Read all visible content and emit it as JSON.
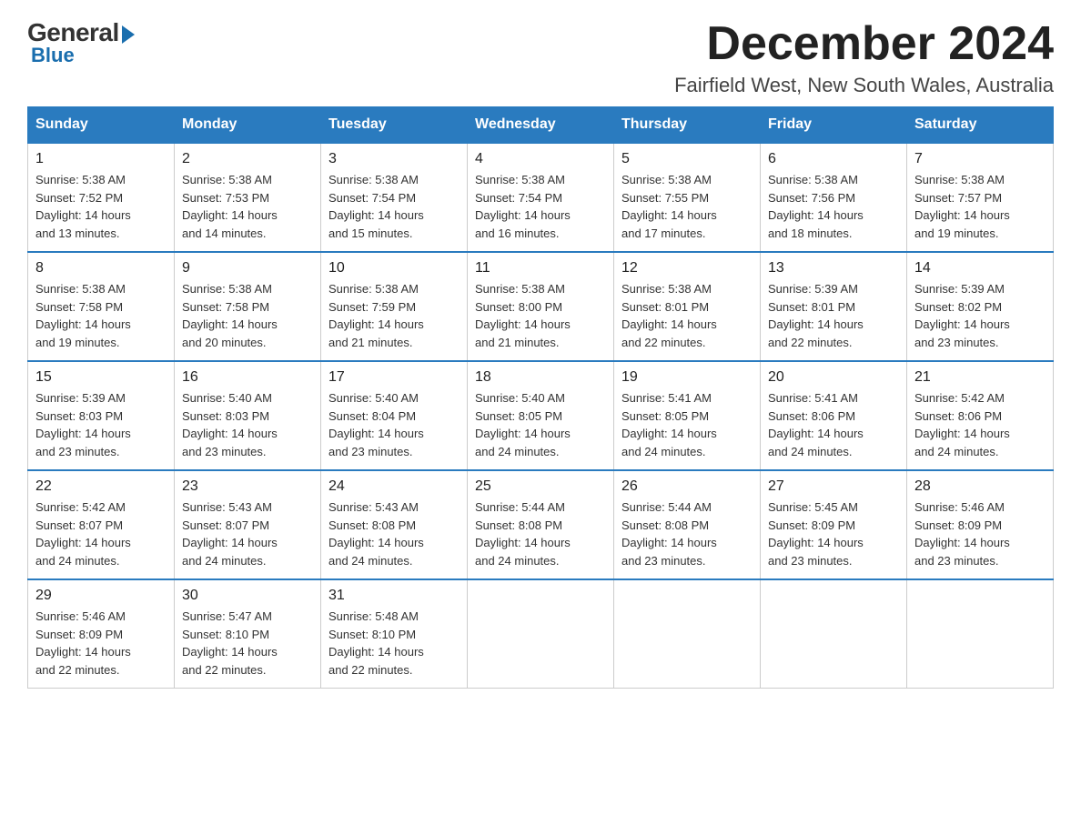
{
  "header": {
    "logo_general": "General",
    "logo_blue": "Blue",
    "month_title": "December 2024",
    "location": "Fairfield West, New South Wales, Australia"
  },
  "days_of_week": [
    "Sunday",
    "Monday",
    "Tuesday",
    "Wednesday",
    "Thursday",
    "Friday",
    "Saturday"
  ],
  "weeks": [
    [
      {
        "day": "1",
        "sunrise": "5:38 AM",
        "sunset": "7:52 PM",
        "daylight": "14 hours and 13 minutes."
      },
      {
        "day": "2",
        "sunrise": "5:38 AM",
        "sunset": "7:53 PM",
        "daylight": "14 hours and 14 minutes."
      },
      {
        "day": "3",
        "sunrise": "5:38 AM",
        "sunset": "7:54 PM",
        "daylight": "14 hours and 15 minutes."
      },
      {
        "day": "4",
        "sunrise": "5:38 AM",
        "sunset": "7:54 PM",
        "daylight": "14 hours and 16 minutes."
      },
      {
        "day": "5",
        "sunrise": "5:38 AM",
        "sunset": "7:55 PM",
        "daylight": "14 hours and 17 minutes."
      },
      {
        "day": "6",
        "sunrise": "5:38 AM",
        "sunset": "7:56 PM",
        "daylight": "14 hours and 18 minutes."
      },
      {
        "day": "7",
        "sunrise": "5:38 AM",
        "sunset": "7:57 PM",
        "daylight": "14 hours and 19 minutes."
      }
    ],
    [
      {
        "day": "8",
        "sunrise": "5:38 AM",
        "sunset": "7:58 PM",
        "daylight": "14 hours and 19 minutes."
      },
      {
        "day": "9",
        "sunrise": "5:38 AM",
        "sunset": "7:58 PM",
        "daylight": "14 hours and 20 minutes."
      },
      {
        "day": "10",
        "sunrise": "5:38 AM",
        "sunset": "7:59 PM",
        "daylight": "14 hours and 21 minutes."
      },
      {
        "day": "11",
        "sunrise": "5:38 AM",
        "sunset": "8:00 PM",
        "daylight": "14 hours and 21 minutes."
      },
      {
        "day": "12",
        "sunrise": "5:38 AM",
        "sunset": "8:01 PM",
        "daylight": "14 hours and 22 minutes."
      },
      {
        "day": "13",
        "sunrise": "5:39 AM",
        "sunset": "8:01 PM",
        "daylight": "14 hours and 22 minutes."
      },
      {
        "day": "14",
        "sunrise": "5:39 AM",
        "sunset": "8:02 PM",
        "daylight": "14 hours and 23 minutes."
      }
    ],
    [
      {
        "day": "15",
        "sunrise": "5:39 AM",
        "sunset": "8:03 PM",
        "daylight": "14 hours and 23 minutes."
      },
      {
        "day": "16",
        "sunrise": "5:40 AM",
        "sunset": "8:03 PM",
        "daylight": "14 hours and 23 minutes."
      },
      {
        "day": "17",
        "sunrise": "5:40 AM",
        "sunset": "8:04 PM",
        "daylight": "14 hours and 23 minutes."
      },
      {
        "day": "18",
        "sunrise": "5:40 AM",
        "sunset": "8:05 PM",
        "daylight": "14 hours and 24 minutes."
      },
      {
        "day": "19",
        "sunrise": "5:41 AM",
        "sunset": "8:05 PM",
        "daylight": "14 hours and 24 minutes."
      },
      {
        "day": "20",
        "sunrise": "5:41 AM",
        "sunset": "8:06 PM",
        "daylight": "14 hours and 24 minutes."
      },
      {
        "day": "21",
        "sunrise": "5:42 AM",
        "sunset": "8:06 PM",
        "daylight": "14 hours and 24 minutes."
      }
    ],
    [
      {
        "day": "22",
        "sunrise": "5:42 AM",
        "sunset": "8:07 PM",
        "daylight": "14 hours and 24 minutes."
      },
      {
        "day": "23",
        "sunrise": "5:43 AM",
        "sunset": "8:07 PM",
        "daylight": "14 hours and 24 minutes."
      },
      {
        "day": "24",
        "sunrise": "5:43 AM",
        "sunset": "8:08 PM",
        "daylight": "14 hours and 24 minutes."
      },
      {
        "day": "25",
        "sunrise": "5:44 AM",
        "sunset": "8:08 PM",
        "daylight": "14 hours and 24 minutes."
      },
      {
        "day": "26",
        "sunrise": "5:44 AM",
        "sunset": "8:08 PM",
        "daylight": "14 hours and 23 minutes."
      },
      {
        "day": "27",
        "sunrise": "5:45 AM",
        "sunset": "8:09 PM",
        "daylight": "14 hours and 23 minutes."
      },
      {
        "day": "28",
        "sunrise": "5:46 AM",
        "sunset": "8:09 PM",
        "daylight": "14 hours and 23 minutes."
      }
    ],
    [
      {
        "day": "29",
        "sunrise": "5:46 AM",
        "sunset": "8:09 PM",
        "daylight": "14 hours and 22 minutes."
      },
      {
        "day": "30",
        "sunrise": "5:47 AM",
        "sunset": "8:10 PM",
        "daylight": "14 hours and 22 minutes."
      },
      {
        "day": "31",
        "sunrise": "5:48 AM",
        "sunset": "8:10 PM",
        "daylight": "14 hours and 22 minutes."
      },
      null,
      null,
      null,
      null
    ]
  ],
  "labels": {
    "sunrise": "Sunrise:",
    "sunset": "Sunset:",
    "daylight": "Daylight:"
  }
}
